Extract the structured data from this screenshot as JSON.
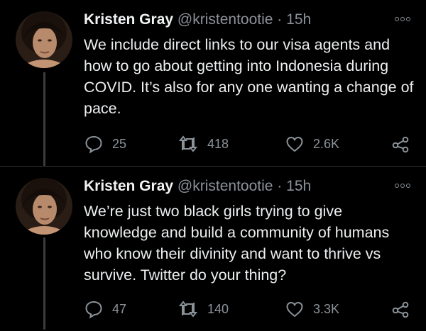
{
  "colors": {
    "background": "#000000",
    "text": "#e7e9ea",
    "muted": "#8b9298"
  },
  "tweets": [
    {
      "author_name": "Kristen Gray",
      "handle": "@kristentootie",
      "separator": "·",
      "time": "15h",
      "text": "We include direct links to our visa agents and how to go about getting into Indonesia during COVID. It’s also for any one wanting a change of pace.",
      "replies": "25",
      "retweets": "418",
      "likes": "2.6K",
      "icons": {
        "more": "more-icon",
        "reply": "reply-icon",
        "retweet": "retweet-icon",
        "like": "heart-icon",
        "share": "share-icon"
      }
    },
    {
      "author_name": "Kristen Gray",
      "handle": "@kristentootie",
      "separator": "·",
      "time": "15h",
      "text": "We’re just two black girls trying to give knowledge and build a community of humans who know their divinity and want to thrive vs survive. Twitter do your thing?",
      "replies": "47",
      "retweets": "140",
      "likes": "3.3K",
      "icons": {
        "more": "more-icon",
        "reply": "reply-icon",
        "retweet": "retweet-icon",
        "like": "heart-icon",
        "share": "share-icon"
      }
    }
  ]
}
